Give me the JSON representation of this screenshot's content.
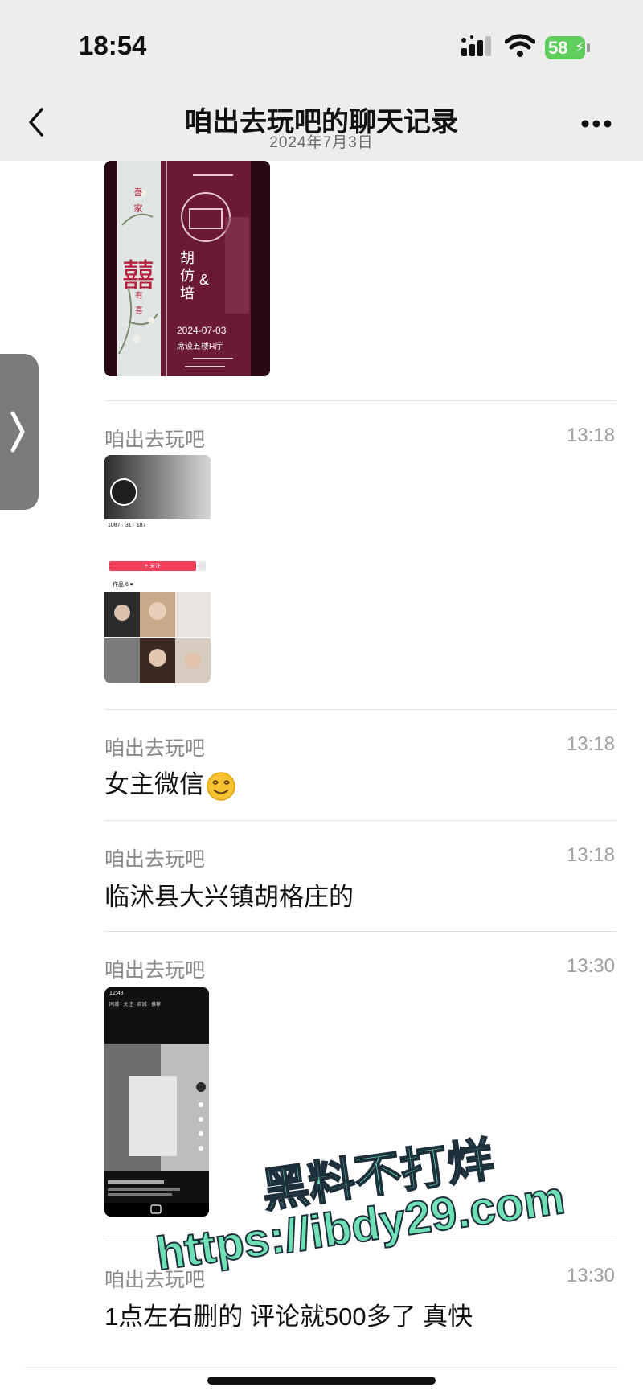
{
  "status_bar": {
    "time": "18:54",
    "battery": "58"
  },
  "header": {
    "title": "咱出去玩吧的聊天记录",
    "date": "2024年7月3日"
  },
  "wedding_card": {
    "couple_line1": "胡",
    "couple_line2": "仿",
    "couple_line3": "培",
    "amp": "&",
    "date": "2024-07-03",
    "venue": "席设五楼H厅",
    "family1": "吾",
    "family2": "家",
    "double_happiness": "囍",
    "joy1": "有",
    "joy2": "喜"
  },
  "messages": [
    {
      "sender": "咱出去玩吧",
      "time": "13:18",
      "type": "image",
      "image": "profile-screenshot"
    },
    {
      "sender": "咱出去玩吧",
      "time": "13:18",
      "type": "text",
      "text": "女主微信",
      "emoji": "dizzy-smile-emoji"
    },
    {
      "sender": "咱出去玩吧",
      "time": "13:18",
      "type": "text",
      "text": "临沭县大兴镇胡格庄的"
    },
    {
      "sender": "咱出去玩吧",
      "time": "13:30",
      "type": "image",
      "image": "video-screenshot"
    },
    {
      "sender": "咱出去玩吧",
      "time": "13:30",
      "type": "text",
      "text": "1点左右删的 评论就500多了 真快"
    }
  ],
  "profile_thumb": {
    "stats": "1087",
    "follow": "31",
    "fans": "187",
    "button": "+ 关注",
    "tab": "作品 6 ▾"
  },
  "video_thumb": {
    "time": "12:48",
    "tabs": "同城 · 关注 · 商城 · 推荐"
  },
  "watermark": {
    "line1": "黑料不打烊",
    "line2": "https://ibdy29.com"
  },
  "colors": {
    "accent": "#5fce5c",
    "watermark": "#6fe0b6",
    "wedding_bg": "#6a1a33",
    "header_bg": "#ededed"
  }
}
